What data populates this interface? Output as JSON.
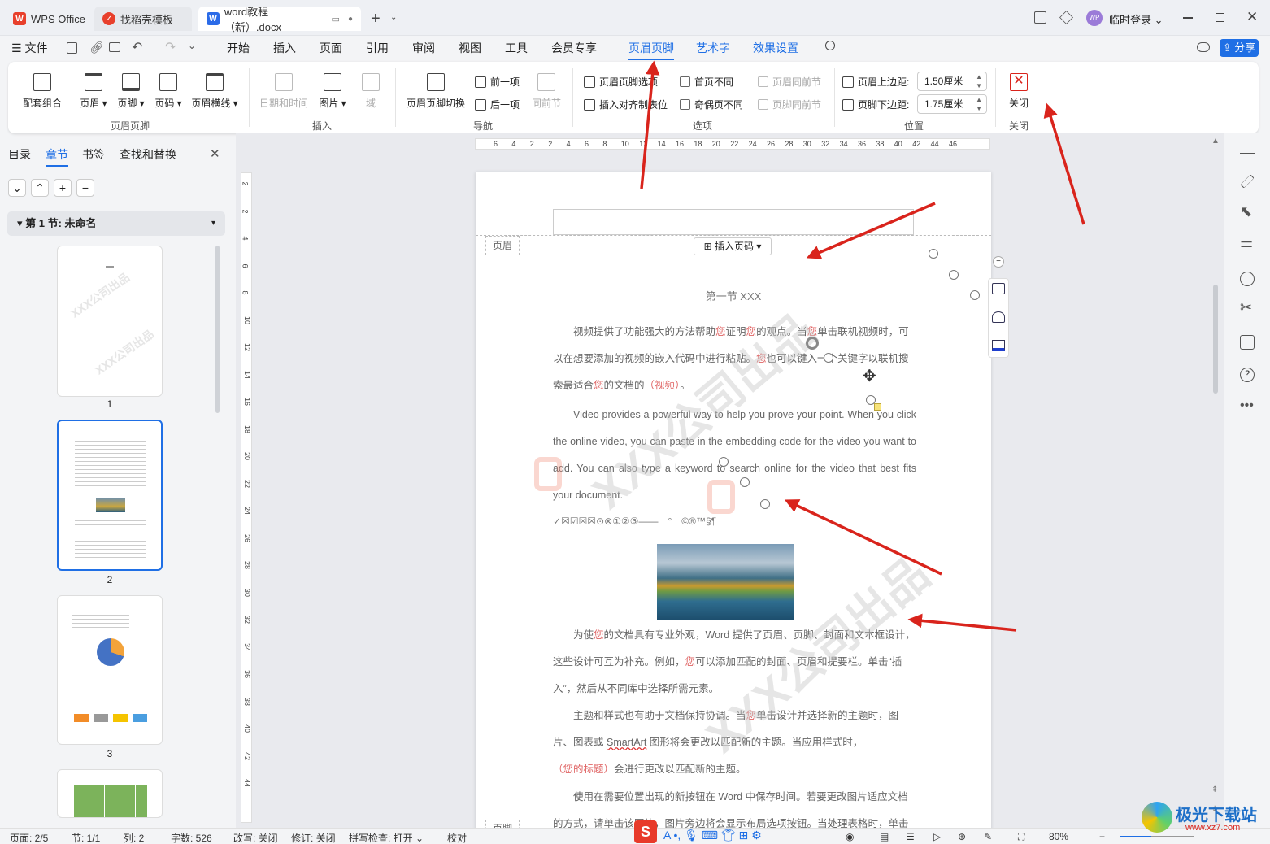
{
  "titlebar": {
    "tabs": [
      {
        "label": "WPS Office",
        "icon": "wps-logo-icon"
      },
      {
        "label": "找稻壳模板",
        "icon": "docer-icon"
      },
      {
        "label": "word教程（新）.docx",
        "icon": "word-doc-icon"
      }
    ],
    "user_label": "临时登录",
    "avatar_text": "WP"
  },
  "menubar": {
    "file": "文件",
    "items": [
      "开始",
      "插入",
      "页面",
      "引用",
      "审阅",
      "视图",
      "工具",
      "会员专享",
      "页眉页脚",
      "艺术字",
      "效果设置"
    ],
    "active": "页眉页脚",
    "share": "分享"
  },
  "ribbon": {
    "big_buttons": [
      {
        "label": "配套组合",
        "icon": "combo-icon"
      },
      {
        "label": "页眉",
        "icon": "header-icon"
      },
      {
        "label": "页脚",
        "icon": "footer-icon"
      },
      {
        "label": "页码",
        "icon": "page-number-icon"
      },
      {
        "label": "页眉横线",
        "icon": "header-line-icon"
      },
      {
        "label": "日期和时间",
        "icon": "date-time-icon"
      },
      {
        "label": "图片",
        "icon": "picture-icon"
      },
      {
        "label": "域",
        "icon": "field-icon"
      },
      {
        "label": "页眉页脚切换",
        "icon": "switch-icon"
      },
      {
        "label": "关闭",
        "icon": "close-x-icon"
      }
    ],
    "nav": {
      "prev": "前一项",
      "next": "后一项",
      "same_prev": "同前节"
    },
    "options": {
      "hf_options": "页眉页脚选项",
      "insert_align_tab": "插入对齐制表位",
      "first_diff": "首页不同",
      "odd_even_diff": "奇偶页不同",
      "header_same_prev": "页眉同前节",
      "footer_same_prev": "页脚同前节"
    },
    "position": {
      "header_top_label": "页眉上边距:",
      "header_top_value": "1.50厘米",
      "footer_bottom_label": "页脚下边距:",
      "footer_bottom_value": "1.75厘米"
    },
    "groups": [
      "页眉页脚",
      "插入",
      "导航",
      "选项",
      "位置",
      "关闭"
    ]
  },
  "leftpanel": {
    "tabs": [
      "目录",
      "章节",
      "书签",
      "查找和替换"
    ],
    "active_tab": "章节",
    "section_title": "第 1 节: 未命名",
    "pages": [
      "1",
      "2",
      "3"
    ]
  },
  "ruler": {
    "h_ticks": [
      "6",
      "4",
      "2",
      "2",
      "4",
      "6",
      "8",
      "10",
      "12",
      "14",
      "16",
      "18",
      "20",
      "22",
      "24",
      "26",
      "28",
      "30",
      "32",
      "34",
      "36",
      "38",
      "40",
      "42",
      "44",
      "46"
    ],
    "v_ticks": [
      "2",
      "2",
      "4",
      "6",
      "8",
      "10",
      "12",
      "14",
      "16",
      "18",
      "20",
      "22",
      "24",
      "26",
      "28",
      "30",
      "32",
      "34",
      "36",
      "38",
      "40",
      "42",
      "44"
    ]
  },
  "document": {
    "header_tag": "页眉",
    "footer_tag": "页脚",
    "insert_page_num": "插入页码",
    "section_heading": "第一节 XXX",
    "p1_parts": [
      "视频提供了功能强大的方法帮助",
      "您",
      "证明",
      "您",
      "的观点。当",
      "您",
      "单击联机视频时，可以在想要添加的视频的嵌入代码中进行粘贴。",
      "您",
      "也可以键入一个关键字以联机搜索最适合",
      "您",
      "的文档的",
      "（视频）",
      "。"
    ],
    "p2": "Video provides a powerful way to help you prove your point. When you click the online video, you can paste in the embedding code for the video you want to add. You can also type a keyword to search online for the video that best fits your document.",
    "symbols": "✓☒☑☒☒⊙⊗①②③——　°　©®™§¶",
    "p3_parts": [
      "为使",
      "您",
      "的文档具有专业外观，Word  提供了页眉、页脚、封面和文本框设计，这些设计可互为补充。例如，",
      "您",
      "可以添加匹配的封面、页眉和提要栏。单击“插入”，然后从不同库中选择所需元素。"
    ],
    "p4_parts": [
      "主题和样式也有助于文档保持协调。当",
      "您",
      "单击设计并选择新的主题时，图片、图表或 ",
      "SmartArt",
      " 图形将会更改以匹配新的主题。当应用样式时，",
      "（您的标题）",
      "会进行更改以匹配新的主题。"
    ],
    "p5": "使用在需要位置出现的新按钮在  Word  中保存时间。若要更改图片适应文档的方式，请单击该图片，图片旁边将会显示布局选项按钮。当处理表格时，单击",
    "watermark": "XXX公司出品"
  },
  "statusbar": {
    "page": "页面: 2/5",
    "section": "节: 1/1",
    "column": "列: 2",
    "words": "字数: 526",
    "revision_mode": "改写: 关闭",
    "track": "修订: 关闭",
    "spell": "拼写检查: 打开",
    "proof": "校对",
    "zoom": "80%"
  },
  "site_watermark": {
    "name": "极光下载站",
    "url": "www.xz7.com"
  },
  "colors": {
    "accent": "#1f6fe5",
    "arrow": "#d9241c",
    "wps_red": "#e8402c"
  }
}
